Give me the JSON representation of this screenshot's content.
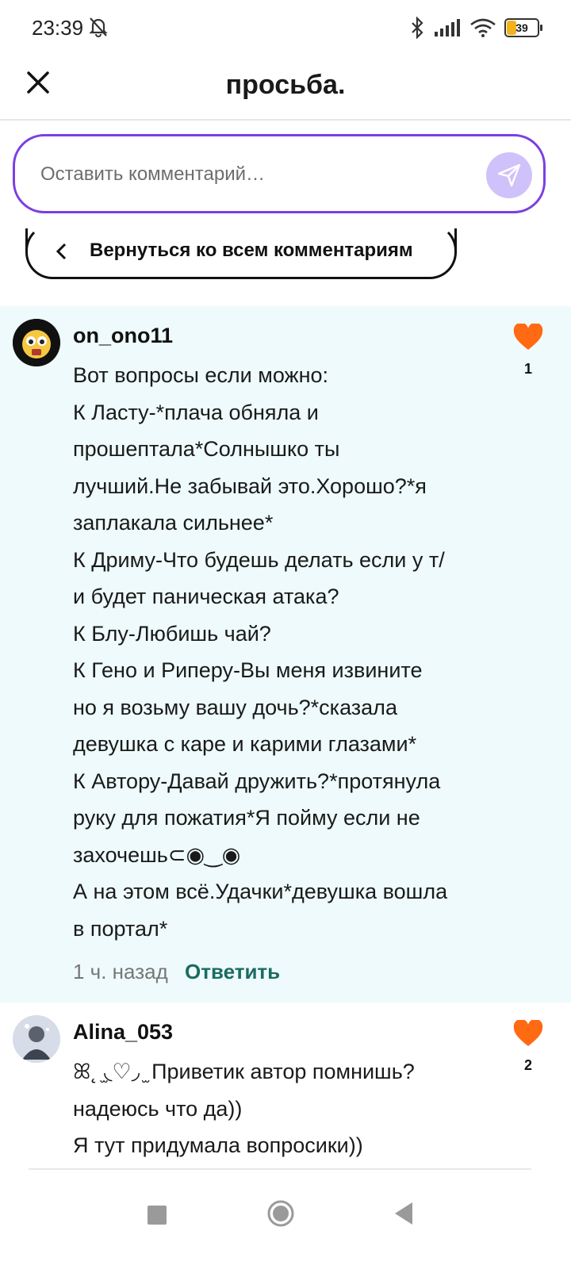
{
  "status_bar": {
    "time": "23:39",
    "battery": "39"
  },
  "header": {
    "title": "просьба."
  },
  "composer": {
    "placeholder": "Оставить комментарий…"
  },
  "back_button": {
    "label": "Вернуться ко всем комментариям"
  },
  "comments": [
    {
      "username": "on_ono11",
      "likes": "1",
      "lines": [
        "Вот вопросы если можно:",
        "К Ласту-*плача обняла и",
        "прошептала*Солнышко ты",
        "лучший.Не забывай это.Хорошо?*я",
        "заплакала сильнее*",
        "К Дриму-Что будешь делать если у т/",
        "и будет паническая атака?",
        "К Блу-Любишь чай?",
        "К Гено и Риперу-Вы меня извините",
        "но я возьму вашу дочь?*сказала",
        "девушка с каре и карими глазами*",
        "К Автору-Давай дружить?*протянула",
        "руку для пожатия*Я пойму если не",
        "захочешь⊂◉‿◉",
        "А на этом всё.Удачки*девушка вошла",
        "в портал*"
      ],
      "time": "1 ч. назад",
      "reply_label": "Ответить"
    },
    {
      "username": "Alina_053",
      "likes": "2",
      "lines": [
        "ꕤ˛ ̫◟♡◞ ̫ Приветик автор помнишь?",
        "надеюсь что да))",
        "Я тут придумала вопросики))"
      ]
    }
  ],
  "colors": {
    "accent": "#7b3fe4",
    "like": "#ff6a13",
    "reply": "#1b6b63",
    "highlight_bg": "#eefafb"
  }
}
